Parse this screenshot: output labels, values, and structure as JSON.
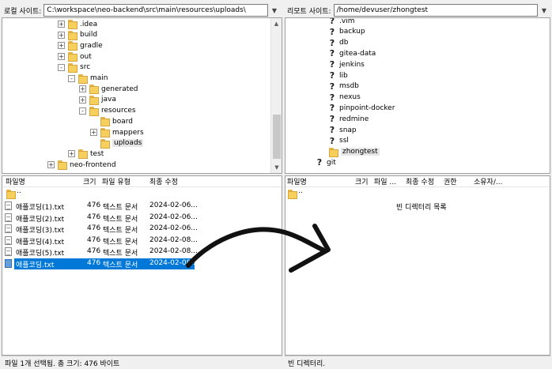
{
  "local": {
    "site_label": "로컬 사이트:",
    "path": "C:\\workspace\\neo-backend\\src\\main\\resources\\uploads\\",
    "tree": [
      {
        "name": ".idea",
        "expander": "+"
      },
      {
        "name": "build",
        "expander": "+"
      },
      {
        "name": "gradle",
        "expander": "+"
      },
      {
        "name": "out",
        "expander": "+"
      },
      {
        "name": "src",
        "expander": "−"
      },
      {
        "name": "main",
        "expander": "−"
      },
      {
        "name": "generated",
        "expander": "+"
      },
      {
        "name": "java",
        "expander": "+"
      },
      {
        "name": "resources",
        "expander": "−"
      },
      {
        "name": "board",
        "expander": ""
      },
      {
        "name": "mappers",
        "expander": "+"
      },
      {
        "name": "uploads",
        "expander": ""
      },
      {
        "name": "test",
        "expander": "+"
      },
      {
        "name": "neo-frontend",
        "expander": "+"
      }
    ],
    "columns": {
      "name": "파일명",
      "size": "크기",
      "type": "파일 유형",
      "modified": "최종 수정"
    },
    "parent_dir": "..",
    "files": [
      {
        "name": "애플코딩(1).txt",
        "size": "476",
        "type": "텍스트 문서",
        "modified": "2024-02-06..."
      },
      {
        "name": "애플코딩(2).txt",
        "size": "476",
        "type": "텍스트 문서",
        "modified": "2024-02-06..."
      },
      {
        "name": "애플코딩(3).txt",
        "size": "476",
        "type": "텍스트 문서",
        "modified": "2024-02-06..."
      },
      {
        "name": "애플코딩(4).txt",
        "size": "476",
        "type": "텍스트 문서",
        "modified": "2024-02-08..."
      },
      {
        "name": "애플코딩(5).txt",
        "size": "476",
        "type": "텍스트 문서",
        "modified": "2024-02-08..."
      },
      {
        "name": "애플코딩.txt",
        "size": "476",
        "type": "텍스트 문서",
        "modified": "2024-02-08..."
      }
    ],
    "status": "파일 1개 선택됨. 총 크기: 476 바이트"
  },
  "remote": {
    "site_label": "리모트 사이트:",
    "path": "/home/devuser/zhongtest",
    "tree": [
      {
        "name": ".vim"
      },
      {
        "name": "backup"
      },
      {
        "name": "db"
      },
      {
        "name": "gitea-data"
      },
      {
        "name": "jenkins"
      },
      {
        "name": "lib"
      },
      {
        "name": "msdb"
      },
      {
        "name": "nexus"
      },
      {
        "name": "pinpoint-docker"
      },
      {
        "name": "redmine"
      },
      {
        "name": "snap"
      },
      {
        "name": "ssl"
      },
      {
        "name": "zhongtest"
      },
      {
        "name": "git"
      }
    ],
    "columns": {
      "name": "파일명",
      "size": "크기",
      "type": "파일 ...",
      "modified": "최종 수정",
      "perm": "권한",
      "owner": "소유자/..."
    },
    "parent_dir": "..",
    "empty_message": "빈 디렉터리 목록",
    "status": "빈 디렉터리."
  }
}
